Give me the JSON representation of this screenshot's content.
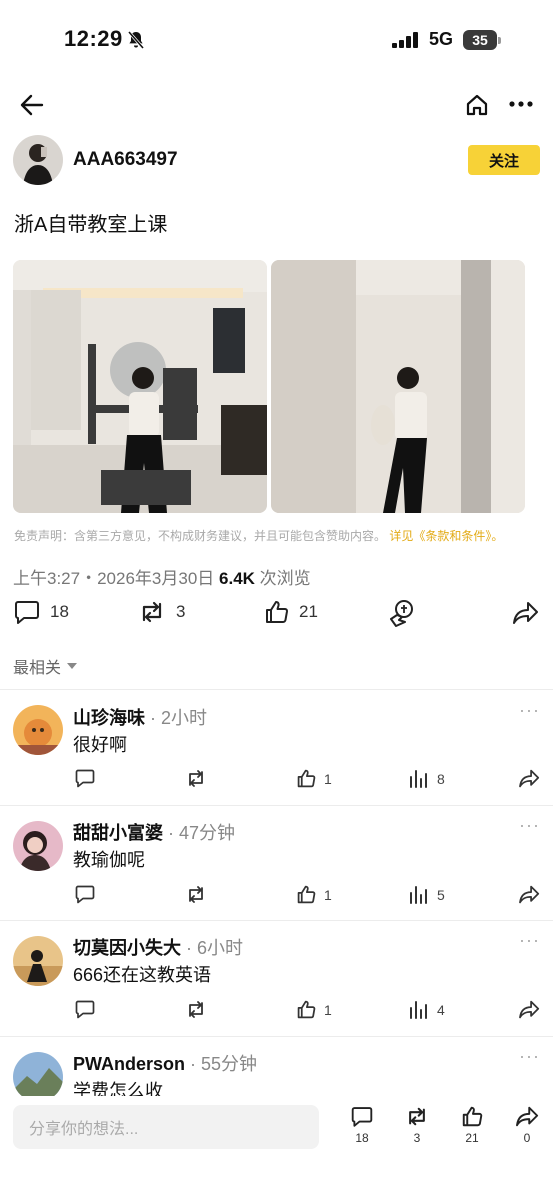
{
  "status": {
    "time": "12:29",
    "network": "5G",
    "battery": "35"
  },
  "author": {
    "name": "AAA663497",
    "follow_label": "关注"
  },
  "post": {
    "text": "浙A自带教室上课",
    "disclaimer_text": "免责声明：含第三方意见，不构成财务建议，并且可能包含赞助内容。",
    "disclaimer_link": "详见《条款和条件》。",
    "timestamp": "上午3:27・2026年3月30日",
    "views_count": "6.4K",
    "views_label": "次浏览"
  },
  "actions": {
    "comments": "18",
    "reposts": "3",
    "likes": "21"
  },
  "sort_label": "最相关",
  "comments": [
    {
      "name": "山珍海味",
      "time": "· 2小时",
      "text": "很好啊",
      "likes": "1",
      "views": "8",
      "more": "···"
    },
    {
      "name": "甜甜小富婆",
      "time": "· 47分钟",
      "text": "教瑜伽呢",
      "likes": "1",
      "views": "5",
      "more": "···"
    },
    {
      "name": "切莫因小失大",
      "time": "· 6小时",
      "text": "666还在这教英语",
      "likes": "1",
      "views": "4",
      "more": "···"
    },
    {
      "name": "PWAnderson",
      "time": "· 55分钟",
      "text": "学费怎么收",
      "more": "···"
    }
  ],
  "bottom_bar": {
    "placeholder": "分享你的想法...",
    "comments": "18",
    "reposts": "3",
    "likes": "21",
    "shares": "0"
  },
  "colors": {
    "accent": "#f7d237",
    "link": "#e3ab16"
  }
}
